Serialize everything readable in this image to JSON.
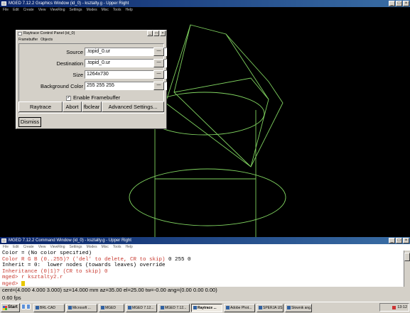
{
  "graphics_window": {
    "title": "MGED 7.12.2 Graphics Window (id_0) - ksztalty.g - Upper Right",
    "menu": [
      "File",
      "Edit",
      "Create",
      "View",
      "ViewRing",
      "Settings",
      "Modes",
      "Misc",
      "Tools",
      "Help"
    ],
    "window_buttons": [
      "_",
      "□",
      "×"
    ],
    "wireframe_color": "#7fd25f"
  },
  "raytrace_panel": {
    "title": "Raytrace Control Panel (id_0)",
    "menu": [
      "Framebuffer",
      "Objects"
    ],
    "fields": [
      {
        "label": "Source",
        "value": ".topid_0.ur",
        "dropdown": "—"
      },
      {
        "label": "Destination",
        "value": ".topid_0.ur",
        "dropdown": "—"
      },
      {
        "label": "Size",
        "value": "1264x730",
        "dropdown": "—"
      },
      {
        "label": "Background Color",
        "value": "255 255 255",
        "dropdown": "—"
      }
    ],
    "enable_framebuffer": {
      "label": "Enable Framebuffer",
      "checked": true,
      "mark": "✓"
    },
    "buttons": {
      "raytrace": "Raytrace",
      "abort": "Abort",
      "fbclear": "fbclear",
      "advanced": "Advanced Settings..."
    },
    "dismiss": "Dismiss",
    "window_buttons": [
      "_",
      "□",
      "×"
    ]
  },
  "command_window": {
    "title": "MGED 7.12.2 Command Window (id_0) - ksztalty.g - Upper Right",
    "menu": [
      "File",
      "Edit",
      "Create",
      "View",
      "ViewRing",
      "Settings",
      "Modes",
      "Misc",
      "Tools",
      "Help"
    ],
    "lines": [
      {
        "text": "Color = (No color specified)",
        "color": "#000000"
      },
      {
        "text": "Color R G B (0..255)? ('del' to delete, CR to skip) 0 255 0",
        "color": "#c8392f",
        "tail_from": 52
      },
      {
        "text": "Inherit = 0:  lower nodes (towards leaves) override",
        "color": "#000000"
      },
      {
        "text": "Inheritance (0|1)? (CR to skip) 0",
        "color": "#c8392f"
      },
      {
        "text": "mged> r ksztalty2.r",
        "color": "#c8392f"
      },
      {
        "text": "mged> ",
        "color": "#c8392f"
      }
    ],
    "status_line": "cent=(4.000 4.000 3.000) sz=14.000  mm  az=35.00  el=25.00  tw=-0.00  ang=(0.00 0.00 0.00)",
    "fps": "0.60 fps",
    "window_buttons": [
      "_",
      "□",
      "×"
    ]
  },
  "taskbar": {
    "start": "Start",
    "tasks": [
      {
        "label": "BRL-CAD",
        "active": false
      },
      {
        "label": "Microsoft ...",
        "active": false
      },
      {
        "label": "MGED",
        "active": false
      },
      {
        "label": "MGED 7.12...",
        "active": false
      },
      {
        "label": "MGED 7.12...",
        "active": false
      },
      {
        "label": "Raytrace ...",
        "active": true
      },
      {
        "label": "Adobe Phot...",
        "active": false
      },
      {
        "label": "SPERJA US...",
        "active": false
      },
      {
        "label": "Słownik ang...",
        "active": false
      }
    ],
    "clock": "13:12"
  }
}
